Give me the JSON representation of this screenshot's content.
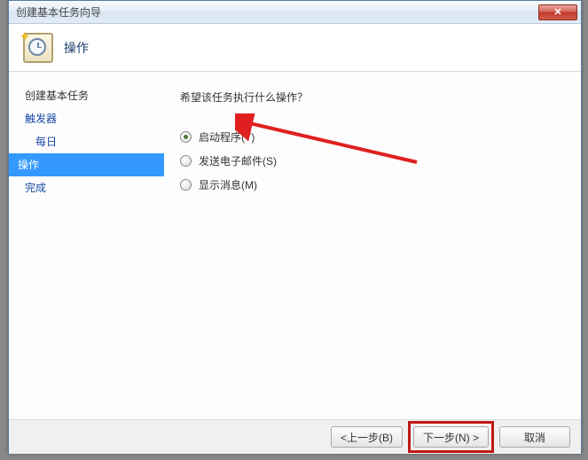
{
  "window": {
    "title": "创建基本任务向导"
  },
  "header": {
    "title": "操作"
  },
  "sidebar": {
    "items": [
      {
        "label": "创建基本任务",
        "plain": true
      },
      {
        "label": "触发器"
      },
      {
        "label": "每日",
        "sub": true
      },
      {
        "label": "操作",
        "selected": true
      },
      {
        "label": "完成"
      }
    ]
  },
  "content": {
    "prompt": "希望该任务执行什么操作？",
    "options": [
      {
        "label": "启动程序(T)",
        "checked": true
      },
      {
        "label": "发送电子邮件(S)",
        "checked": false
      },
      {
        "label": "显示消息(M)",
        "checked": false
      }
    ]
  },
  "footer": {
    "back": "<上一步(B)",
    "next": "下一步(N) >",
    "cancel": "取消"
  }
}
